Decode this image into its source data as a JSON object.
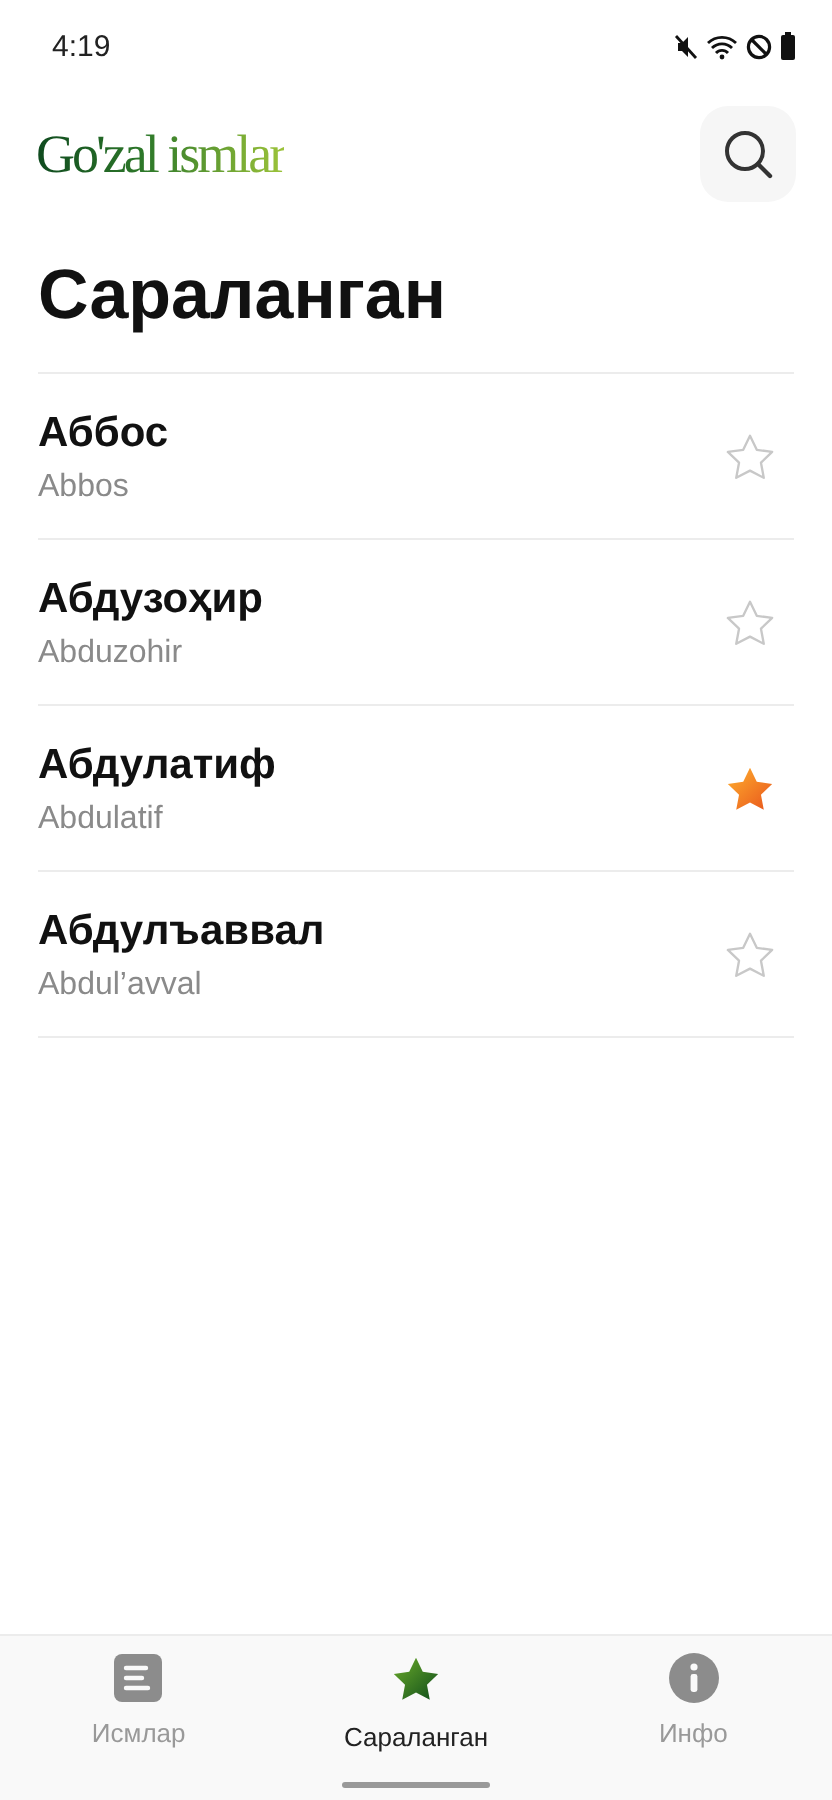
{
  "status_bar": {
    "time": "4:19"
  },
  "app": {
    "logo": "Go'zal ismlar"
  },
  "title": "Сараланган",
  "names": [
    {
      "name": "Аббос",
      "latin": "Abbos",
      "favorite": false
    },
    {
      "name": "Абдузоҳир",
      "latin": "Abduzohir",
      "favorite": false
    },
    {
      "name": "Абдулатиф",
      "latin": "Abdulatif",
      "favorite": true
    },
    {
      "name": "Абдулъаввал",
      "latin": "Abdul’avval",
      "favorite": false
    }
  ],
  "tabs": [
    {
      "label": "Исмлар",
      "kind": "list",
      "selected": false
    },
    {
      "label": "Сараланган",
      "kind": "star",
      "selected": true
    },
    {
      "label": "Инфо",
      "kind": "info",
      "selected": false
    }
  ]
}
